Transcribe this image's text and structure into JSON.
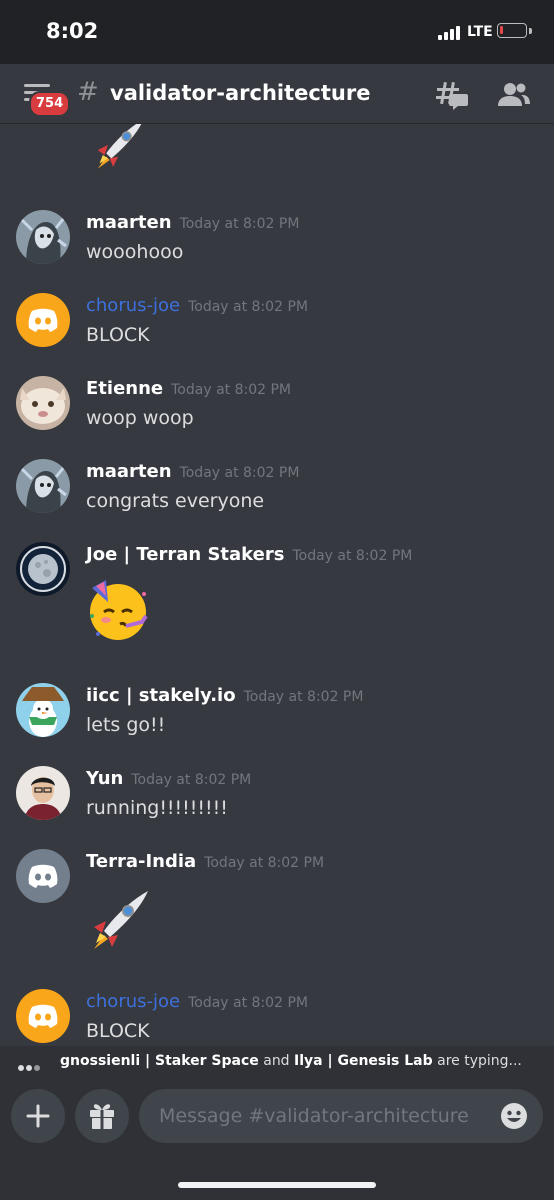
{
  "status_bar": {
    "time": "8:02",
    "network": "LTE"
  },
  "header": {
    "badge_count": "754",
    "channel": "validator-architecture"
  },
  "messages": [
    {
      "author": "maarten",
      "time": "Today at 8:02 PM",
      "text": "wooohooo",
      "author_color": "#ffffff"
    },
    {
      "author": "chorus-joe",
      "time": "Today at 8:02 PM",
      "text": "BLOCK",
      "author_color": "#3e70dd"
    },
    {
      "author": "Etienne",
      "time": "Today at 8:02 PM",
      "text": "woop woop",
      "author_color": "#ffffff"
    },
    {
      "author": "maarten",
      "time": "Today at 8:02 PM",
      "text": "congrats everyone",
      "author_color": "#ffffff"
    },
    {
      "author": "Joe | Terran Stakers",
      "time": "Today at 8:02 PM",
      "emoji": "partying-face",
      "author_color": "#ffffff"
    },
    {
      "author": "iicc | stakely.io",
      "time": "Today at 8:02 PM",
      "text": "lets go!!",
      "author_color": "#ffffff"
    },
    {
      "author": "Yun",
      "time": "Today at 8:02 PM",
      "text": "running!!!!!!!!!",
      "author_color": "#ffffff"
    },
    {
      "author": "Terra-India",
      "time": "Today at 8:02 PM",
      "emoji": "rocket",
      "author_color": "#ffffff"
    },
    {
      "author": "chorus-joe",
      "time": "Today at 8:02 PM",
      "text": "BLOCK",
      "author_color": "#3e70dd"
    }
  ],
  "typing": {
    "user1": "gnossienli | Staker Space",
    "connector": "and",
    "user2": "Ilya | Genesis Lab",
    "suffix": "are typing..."
  },
  "composer": {
    "placeholder": "Message #validator-architecture"
  },
  "colors": {
    "background": "#36393f",
    "bar": "#2f3136",
    "blurple": "#5865f2",
    "discord_orange": "#faa61a",
    "discord_grey": "#747f8d",
    "link_blue": "#3e70dd",
    "badge_red": "#d83c3e"
  }
}
